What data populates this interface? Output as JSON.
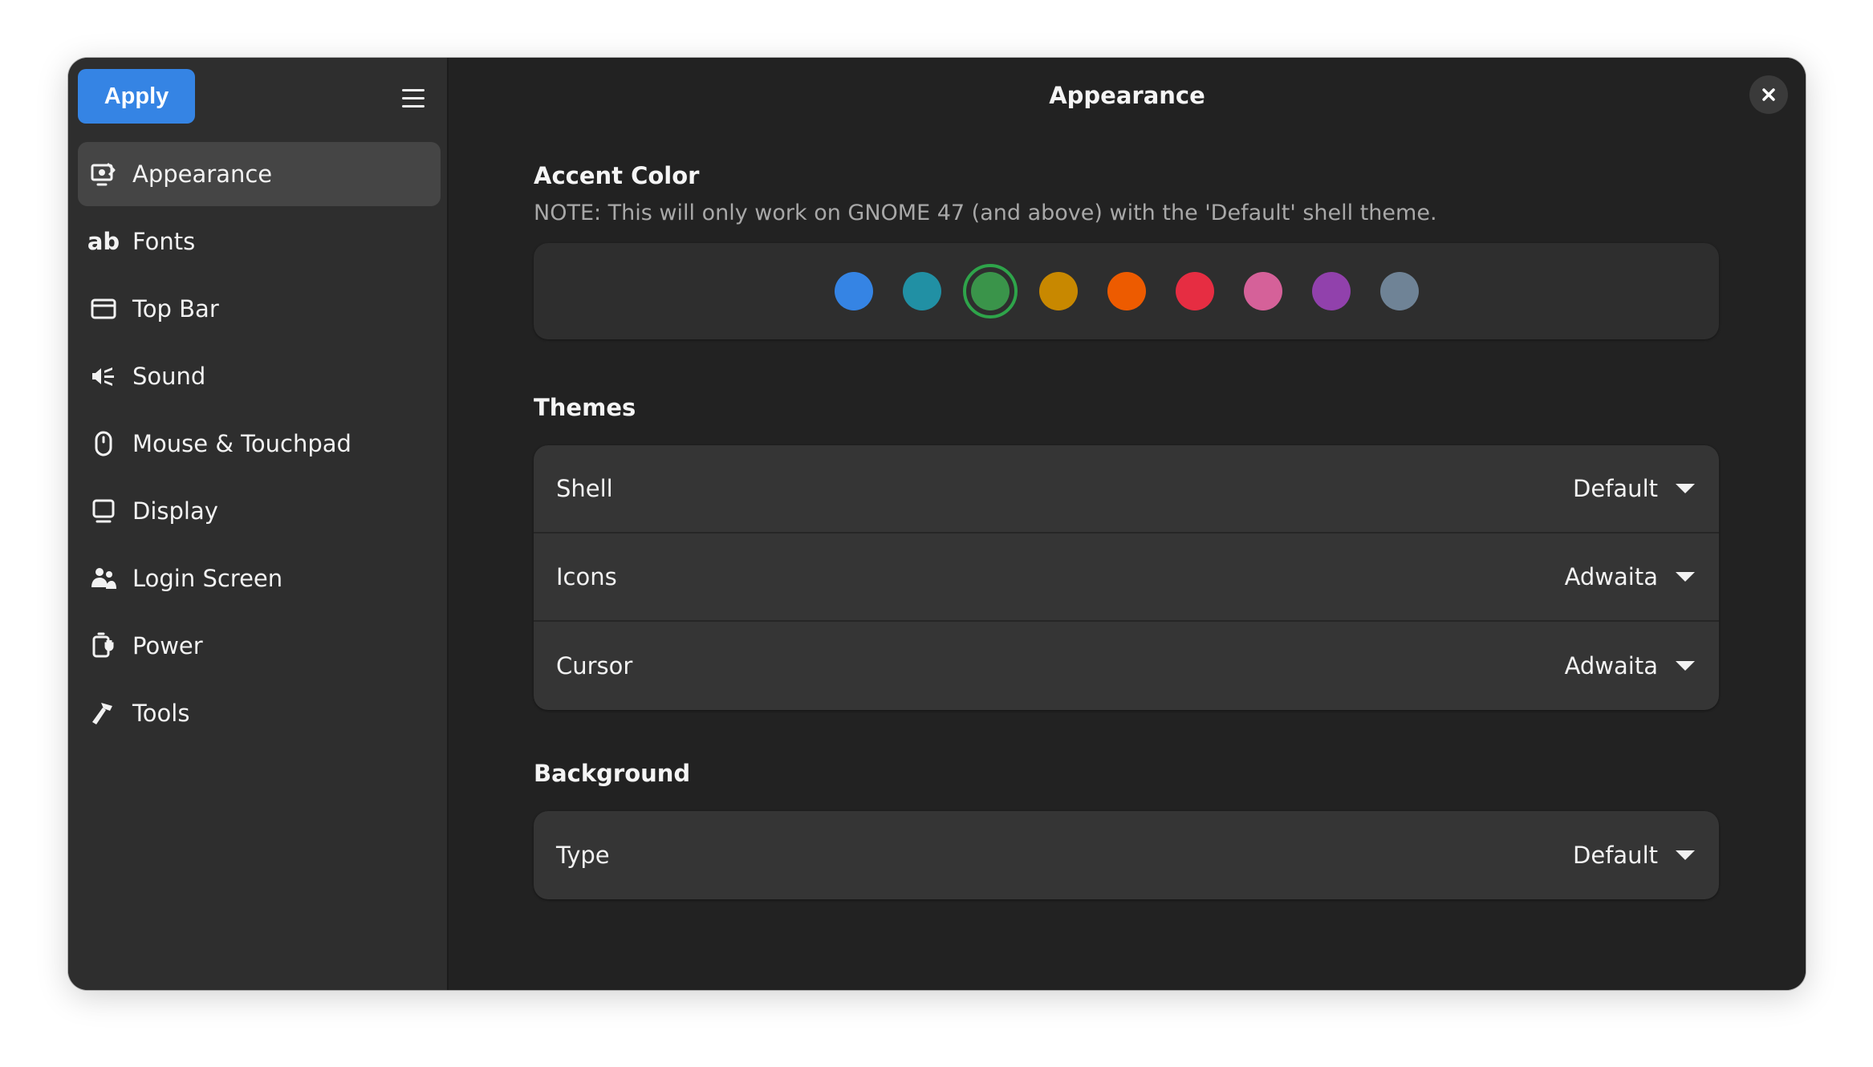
{
  "sidebar": {
    "apply_label": "Apply",
    "items": [
      {
        "label": "Appearance",
        "icon": "appearance-icon",
        "active": true
      },
      {
        "label": "Fonts",
        "icon": "fonts-icon",
        "active": false
      },
      {
        "label": "Top Bar",
        "icon": "top-bar-icon",
        "active": false
      },
      {
        "label": "Sound",
        "icon": "sound-icon",
        "active": false
      },
      {
        "label": "Mouse & Touchpad",
        "icon": "mouse-icon",
        "active": false
      },
      {
        "label": "Display",
        "icon": "display-icon",
        "active": false
      },
      {
        "label": "Login Screen",
        "icon": "login-screen-icon",
        "active": false
      },
      {
        "label": "Power",
        "icon": "power-icon",
        "active": false
      },
      {
        "label": "Tools",
        "icon": "tools-icon",
        "active": false
      }
    ],
    "fonts_glyph": "ab"
  },
  "header": {
    "title": "Appearance"
  },
  "accent": {
    "title": "Accent Color",
    "note": "NOTE: This will only work on GNOME 47 (and above) with the 'Default' shell theme.",
    "colors": [
      "#3584e4",
      "#2190a4",
      "#3a944a",
      "#c88800",
      "#ed5b00",
      "#e62d42",
      "#d56199",
      "#9141ac",
      "#6f8396"
    ],
    "selected_index": 2
  },
  "themes": {
    "title": "Themes",
    "rows": [
      {
        "label": "Shell",
        "value": "Default"
      },
      {
        "label": "Icons",
        "value": "Adwaita"
      },
      {
        "label": "Cursor",
        "value": "Adwaita"
      }
    ]
  },
  "background": {
    "title": "Background",
    "rows": [
      {
        "label": "Type",
        "value": "Default"
      }
    ]
  }
}
